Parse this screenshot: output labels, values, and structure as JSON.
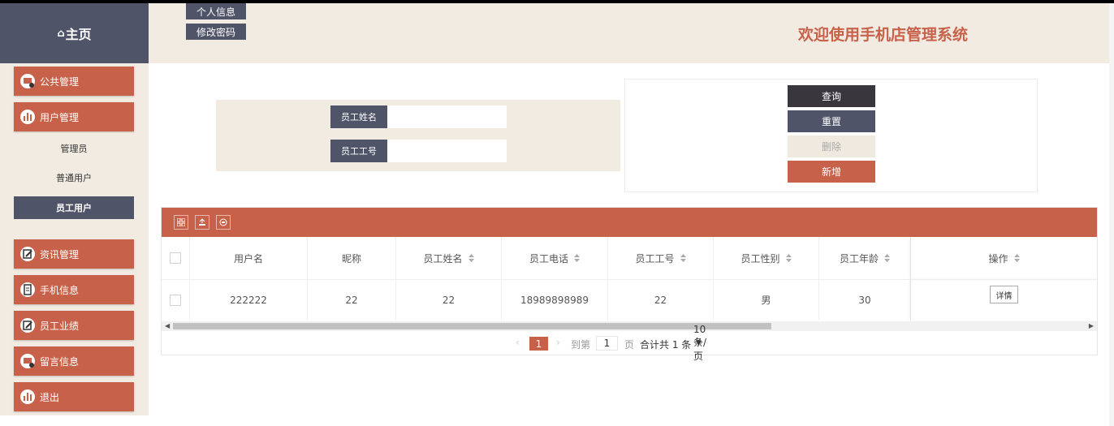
{
  "app": {
    "home_label": "主页",
    "system_title": "欢迎使用手机店管理系统",
    "header_buttons": [
      "个人信息",
      "修改密码"
    ]
  },
  "sidebar": {
    "menus": [
      {
        "label": "公共管理",
        "icon": "dashboard-icon"
      },
      {
        "label": "用户管理",
        "icon": "bar-chart-icon"
      },
      {
        "label": "资讯管理",
        "icon": "edit-icon"
      },
      {
        "label": "手机信息",
        "icon": "clipboard-icon"
      },
      {
        "label": "员工业绩",
        "icon": "edit-icon"
      },
      {
        "label": "留言信息",
        "icon": "dashboard-icon"
      },
      {
        "label": "退出",
        "icon": "bar-chart-icon"
      }
    ],
    "sub_items": [
      {
        "label": "管理员",
        "active": false
      },
      {
        "label": "普通用户",
        "active": false
      },
      {
        "label": "员工用户",
        "active": true
      }
    ]
  },
  "search": {
    "name_label": "员工姓名",
    "name_value": "",
    "id_label": "员工工号",
    "id_value": ""
  },
  "actions": {
    "query": "查询",
    "reset": "重置",
    "delete": "删除",
    "add": "新增"
  },
  "table": {
    "columns": [
      "用户名",
      "昵称",
      "员工姓名",
      "员工电话",
      "员工工号",
      "员工性别",
      "员工年龄",
      "操作"
    ],
    "rows": [
      {
        "username": "222222",
        "nickname": "22",
        "name": "22",
        "phone": "18989898989",
        "staff_id": "22",
        "gender": "男",
        "age": "30",
        "action": "详情"
      }
    ]
  },
  "pagination": {
    "current_page": "1",
    "goto_label": "到第",
    "goto_value": "1",
    "page_unit": "页",
    "total_text": "合计共 1 条",
    "page_size": "10 条/页"
  },
  "colors": {
    "accent": "#c8614a",
    "dark": "#4f5468",
    "beige": "#f1ebe1",
    "query_btn": "#3a363d",
    "delete_btn": "#efe9df"
  }
}
